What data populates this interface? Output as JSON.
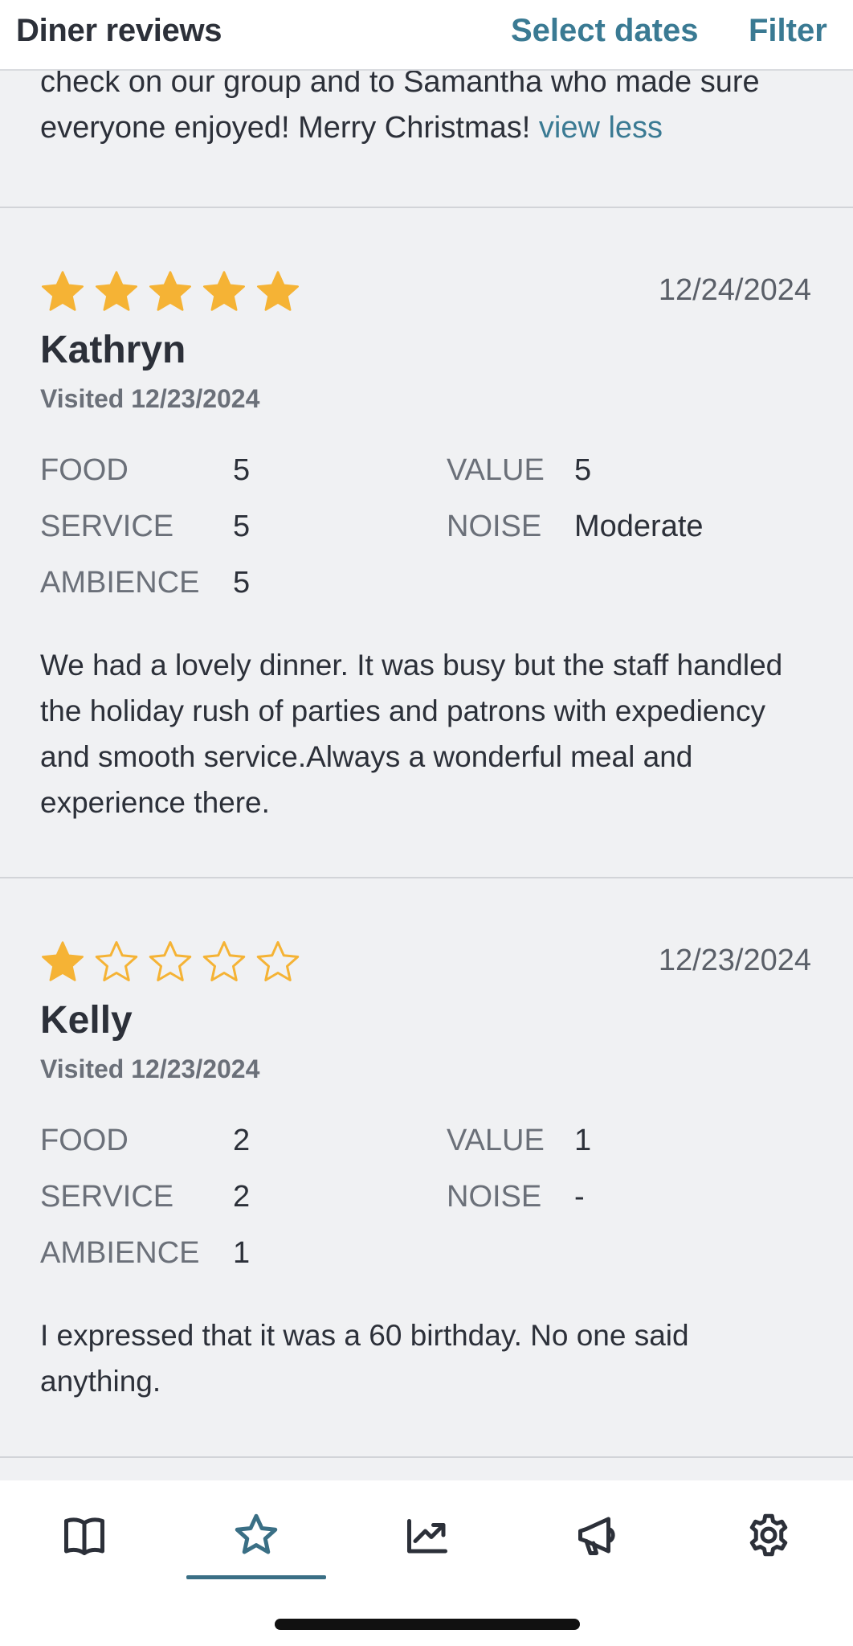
{
  "header": {
    "title": "Diner reviews",
    "select_dates": "Select dates",
    "filter": "Filter"
  },
  "previous_review": {
    "text_line1": "check on our group and to Samantha who made sure",
    "text_line2": "everyone enjoyed! Merry Christmas!",
    "view_less": "view less"
  },
  "reviews": [
    {
      "stars": 5,
      "date": "12/24/2024",
      "name": "Kathryn",
      "visited": "Visited 12/23/2024",
      "labels": {
        "food": "FOOD",
        "service": "SERVICE",
        "ambience": "AMBIENCE",
        "value": "VALUE",
        "noise": "NOISE"
      },
      "food": "5",
      "service": "5",
      "ambience": "5",
      "value": "5",
      "noise": "Moderate",
      "text": "We had a lovely dinner. It was busy but the staff handled the holiday rush of parties and patrons with expediency and smooth service.Always a wonderful meal and experience there."
    },
    {
      "stars": 1,
      "date": "12/23/2024",
      "name": "Kelly",
      "visited": "Visited 12/23/2024",
      "labels": {
        "food": "FOOD",
        "service": "SERVICE",
        "ambience": "AMBIENCE",
        "value": "VALUE",
        "noise": "NOISE"
      },
      "food": "2",
      "service": "2",
      "ambience": "1",
      "value": "1",
      "noise": "-",
      "text": "I expressed that it was a 60 birthday. No one said anything."
    }
  ],
  "colors": {
    "accent": "#3a7a93",
    "star_filled": "#f5b335",
    "star_outline": "#f5b335"
  },
  "bottom_nav": {
    "items": [
      "book-icon",
      "star-icon",
      "trending-chart-icon",
      "megaphone-icon",
      "gear-icon"
    ],
    "selected_index": 1
  }
}
